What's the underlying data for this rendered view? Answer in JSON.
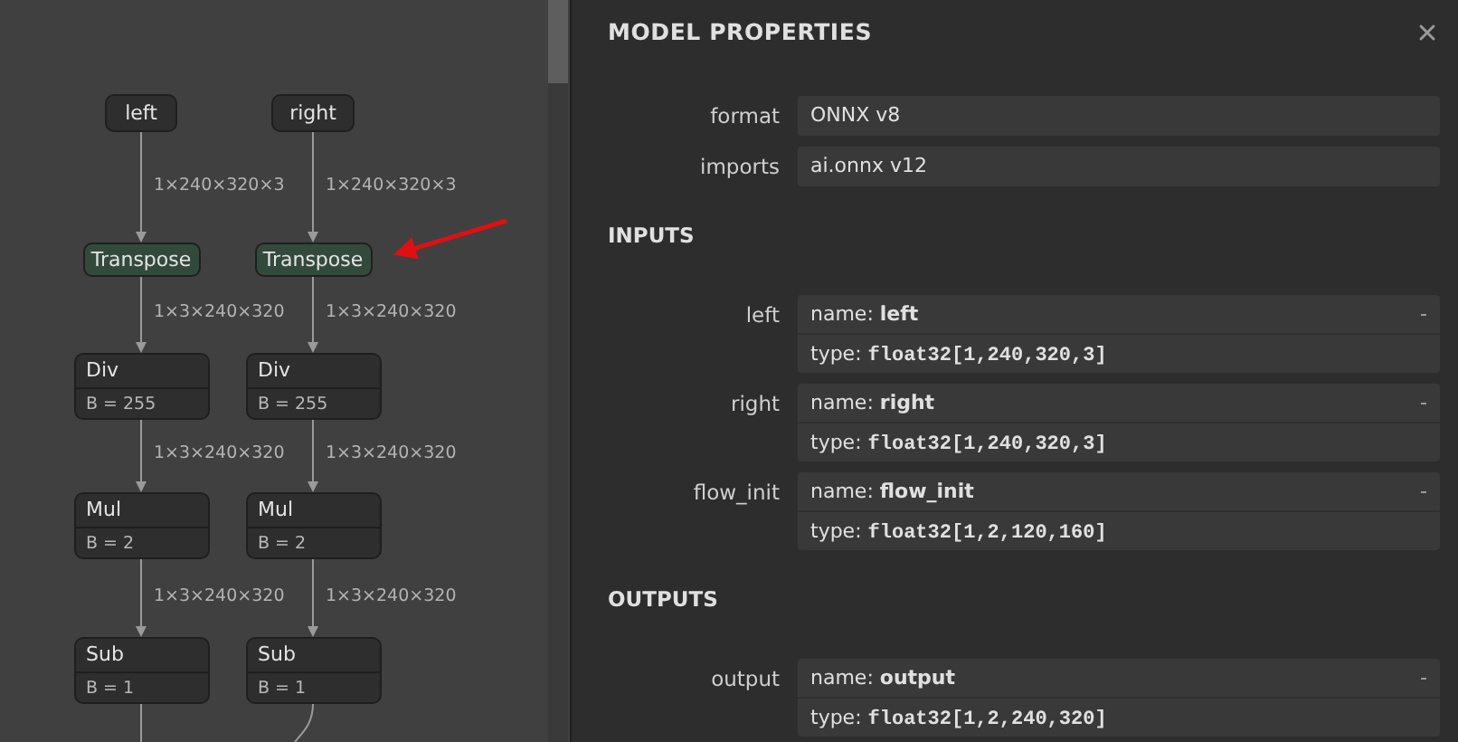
{
  "graph": {
    "columns": [
      {
        "nodes": [
          {
            "kind": "input",
            "label": "left"
          },
          {
            "kind": "layer",
            "label": "Transpose"
          },
          {
            "kind": "op",
            "label": "Div",
            "attribute": "B = 255"
          },
          {
            "kind": "op",
            "label": "Mul",
            "attribute": "B = 2"
          },
          {
            "kind": "op",
            "label": "Sub",
            "attribute": "B = 1"
          }
        ],
        "edges": [
          "1×240×320×3",
          "1×3×240×320",
          "1×3×240×320",
          "1×3×240×320"
        ]
      },
      {
        "nodes": [
          {
            "kind": "input",
            "label": "right"
          },
          {
            "kind": "layer",
            "label": "Transpose"
          },
          {
            "kind": "op",
            "label": "Div",
            "attribute": "B = 255"
          },
          {
            "kind": "op",
            "label": "Mul",
            "attribute": "B = 2"
          },
          {
            "kind": "op",
            "label": "Sub",
            "attribute": "B = 1"
          }
        ],
        "edges": [
          "1×240×320×3",
          "1×3×240×320",
          "1×3×240×320",
          "1×3×240×320"
        ]
      }
    ]
  },
  "panel": {
    "title": "MODEL PROPERTIES",
    "properties": [
      {
        "label": "format",
        "value": "ONNX v8"
      },
      {
        "label": "imports",
        "value": "ai.onnx v12"
      }
    ],
    "sections": [
      {
        "title": "INPUTS",
        "items": [
          {
            "label": "left",
            "name_label": "name:",
            "name": "left",
            "type_label": "type:",
            "type": "float32[1,240,320,3]",
            "toggle": "-"
          },
          {
            "label": "right",
            "name_label": "name:",
            "name": "right",
            "type_label": "type:",
            "type": "float32[1,240,320,3]",
            "toggle": "-"
          },
          {
            "label": "flow_init",
            "name_label": "name:",
            "name": "flow_init",
            "type_label": "type:",
            "type": "float32[1,2,120,160]",
            "toggle": "-"
          }
        ]
      },
      {
        "title": "OUTPUTS",
        "items": [
          {
            "label": "output",
            "name_label": "name:",
            "name": "output",
            "type_label": "type:",
            "type": "float32[1,2,240,320]",
            "toggle": "-"
          }
        ]
      }
    ]
  }
}
